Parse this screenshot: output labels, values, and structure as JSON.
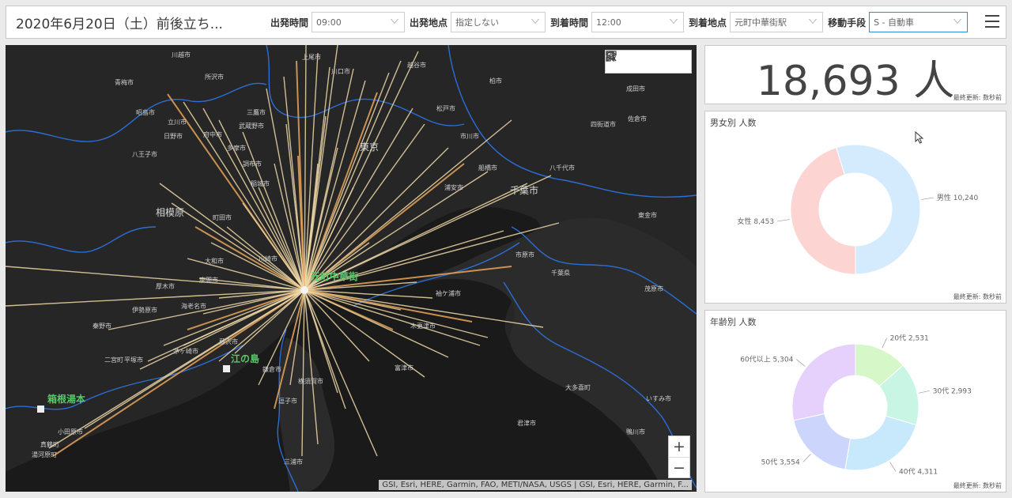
{
  "header": {
    "title": "2020年6月20日（土）前後立ち...",
    "filters": [
      {
        "label": "出発時間",
        "value": "09:00"
      },
      {
        "label": "出発地点",
        "value": "指定しない"
      },
      {
        "label": "到着時間",
        "value": "12:00"
      },
      {
        "label": "到着地点",
        "value": "元町中華街駅"
      },
      {
        "label": "移動手段",
        "value": "S - 自動車"
      }
    ]
  },
  "map": {
    "destination_label": "元町中華街",
    "places": {
      "sagamihara": "相模原",
      "tokyo": "東京",
      "chiba": "千葉市",
      "enoshima": "江の島",
      "hakone": "箱根湯本",
      "kawasaki": "川崎市",
      "hachioji": "八王子市",
      "yokosuka": "横須賀市",
      "kisarazu": "木更津市",
      "futtsu": "富津市",
      "ichihara": "市原市",
      "ichikawa": "市川市",
      "funabashi": "船橋市",
      "odawara": "小田原市",
      "atsugi": "厚木市",
      "hiratsuka": "平塚市",
      "kamakura": "鎌倉市",
      "fujisawa": "藤沢市",
      "yamato": "大和市",
      "machida": "町田市",
      "fuchu": "府中市",
      "chofu": "調布市",
      "tokorozawa": "所沢市",
      "kawagoe": "川越市",
      "kawaguchi": "川口市",
      "matsudo": "松戸市",
      "kashiwa": "柏市",
      "narita": "成田市",
      "ome": "青梅市",
      "yotsukaido": "四街道市",
      "mobara": "茂原市",
      "sodegaura": "袖ケ浦市",
      "chiba_pref": "千葉県",
      "isumi": "いすみ市",
      "tougane": "東金市",
      "sakura": "佐倉市",
      "hadano": "秦野市",
      "isehara": "伊勢原市",
      "ebina": "海老名市",
      "zama": "座間市",
      "chigasaki": "茅ヶ崎市",
      "zushi": "逗子市",
      "miura": "三浦市",
      "kimitsu": "君津市",
      "yachiyo": "八千代市",
      "urayasu": "浦安市",
      "tama": "多摩市",
      "inagi": "稲城市",
      "hino": "日野市",
      "akishima": "昭島市",
      "tachikawa": "立川市",
      "mitaka": "三鷹市",
      "musashino": "武蔵野市",
      "ageo": "上尾市",
      "koshigaya": "越谷市",
      "kamogawa": "鴨川市",
      "otaki": "大多喜町",
      "ninomiya": "二宮町",
      "manazuru": "真鶴町",
      "yugawara": "湯河原町"
    },
    "attribution": "GSI, Esri, HERE, Garmin, FAO, METI/NASA, USGS | GSI, Esri, HERE, Garmin, F...",
    "zoom_in": "+",
    "zoom_out": "−"
  },
  "summary": {
    "total": "18,693 人",
    "updated": "最終更新: 数秒前"
  },
  "gender_panel": {
    "title": "男女別 人数",
    "updated": "最終更新: 数秒前",
    "colors": {
      "female": "#fcd5d3",
      "male": "#d3ebfc"
    }
  },
  "age_panel": {
    "title": "年齢別 人数",
    "updated": "最終更新: 数秒前",
    "colors": [
      "#d6f7c8",
      "#c8f5e4",
      "#c8e8fc",
      "#ccd6fc",
      "#e6d0fc"
    ]
  },
  "chart_data": [
    {
      "type": "pie",
      "title": "男女別 人数",
      "categories": [
        "女性",
        "男性"
      ],
      "values": [
        8453,
        10240
      ]
    },
    {
      "type": "pie",
      "title": "年齢別 人数",
      "categories": [
        "20代",
        "30代",
        "40代",
        "50代",
        "60代以上"
      ],
      "values": [
        2531,
        2993,
        4311,
        3554,
        5304
      ]
    }
  ]
}
